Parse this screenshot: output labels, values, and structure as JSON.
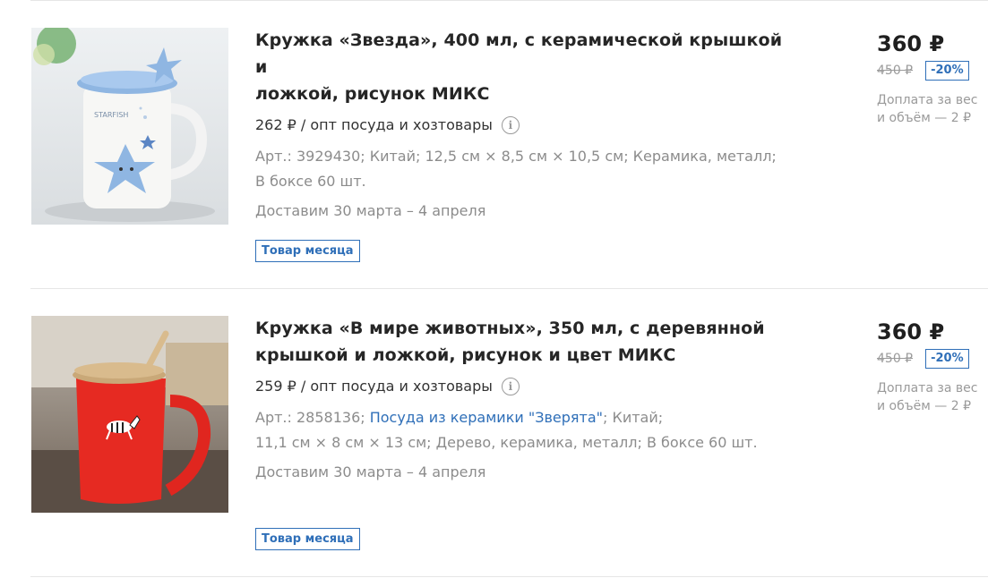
{
  "products": [
    {
      "title_line1": "Кружка «Звезда», 400 мл, с керамической крышкой и",
      "title_line2": "ложкой, рисунок МИКС",
      "wholesale": "262 ₽ / опт посуда и хозтовары",
      "specs_line1": "Арт.: 3929430; Китай; 12,5 см × 8,5 см × 10,5 см; Керамика, металл;",
      "specs_line2": "В боксе 60 шт.",
      "delivery": "Доставим 30 марта – 4 апреля",
      "badge": "Товар месяца",
      "price": "360 ₽",
      "old_price": "450 ₽",
      "discount": "-20%",
      "surcharge_line1": "Доплата за вес",
      "surcharge_line2": "и объём — 2 ₽",
      "image_text": "STARFISH"
    },
    {
      "title_line1": "Кружка «В мире животных», 350 мл, с деревянной",
      "title_line2": "крышкой и ложкой, рисунок и цвет МИКС",
      "wholesale": "259 ₽ / опт посуда и хозтовары",
      "specs_prefix": "Арт.: 2858136; ",
      "specs_link": "Посуда из керамики \"Зверята\"",
      "specs_suffix": "; Китай;",
      "specs_line2": "11,1 см × 8 см × 13 см; Дерево, керамика, металл; В боксе 60 шт.",
      "delivery": "Доставим 30 марта – 4 апреля",
      "badge": "Товар месяца",
      "price": "360 ₽",
      "old_price": "450 ₽",
      "discount": "-20%",
      "surcharge_line1": "Доплата за вес",
      "surcharge_line2": "и объём — 2 ₽"
    }
  ],
  "icons": {
    "info": "info-circle-icon"
  },
  "colors": {
    "accent": "#2f6fb8",
    "muted": "#8c8c8c"
  }
}
